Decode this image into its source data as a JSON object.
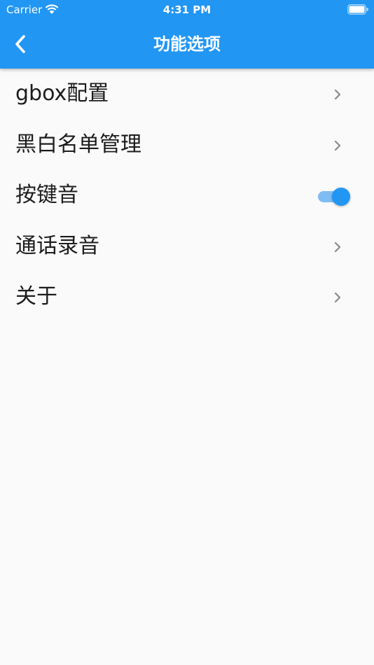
{
  "status_bar": {
    "carrier": "Carrier",
    "time": "4:31 PM"
  },
  "app_bar": {
    "title": "功能选项",
    "back_icon": "chevron-left-icon"
  },
  "menu": {
    "items": [
      {
        "label": "gbox配置",
        "trailing": "chevron-right-icon"
      },
      {
        "label": "黑白名单管理",
        "trailing": "chevron-right-icon"
      },
      {
        "label": "按键音",
        "trailing": "toggle-switch",
        "enabled": true
      },
      {
        "label": "通话录音",
        "trailing": "chevron-right-icon"
      },
      {
        "label": "关于",
        "trailing": "chevron-right-icon"
      }
    ]
  },
  "colors": {
    "primary": "#2196f3",
    "toggle_track": "#7fbcf3",
    "background": "#fafafa",
    "chevron": "#8a8a8a"
  }
}
